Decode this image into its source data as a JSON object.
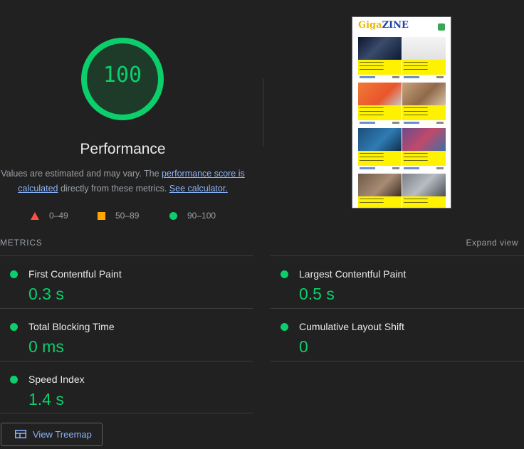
{
  "score": {
    "value": "100",
    "fraction": 1.0,
    "title": "Performance",
    "color": "#0cce6b"
  },
  "description": {
    "part1": "Values are estimated and may vary. The ",
    "link1": "performance score is calculated",
    "part2": " directly from these metrics. ",
    "link2": "See calculator."
  },
  "legend": [
    {
      "range": "0–49",
      "shape": "triangle",
      "color": "#ff4e42"
    },
    {
      "range": "50–89",
      "shape": "square",
      "color": "#ffa400"
    },
    {
      "range": "90–100",
      "shape": "circle",
      "color": "#0cce6b"
    }
  ],
  "thumbnail": {
    "logo_g": "Gi",
    "logo_rest": "ga",
    "logo_end": "ZINE"
  },
  "metrics": {
    "label": "METRICS",
    "expand_label": "Expand view",
    "items": [
      {
        "name": "First Contentful Paint",
        "value": "0.3 s"
      },
      {
        "name": "Largest Contentful Paint",
        "value": "0.5 s"
      },
      {
        "name": "Total Blocking Time",
        "value": "0 ms"
      },
      {
        "name": "Cumulative Layout Shift",
        "value": "0"
      },
      {
        "name": "Speed Index",
        "value": "1.4 s"
      }
    ]
  },
  "treemap_button": {
    "label": "View Treemap",
    "icon": "treemap-icon"
  }
}
